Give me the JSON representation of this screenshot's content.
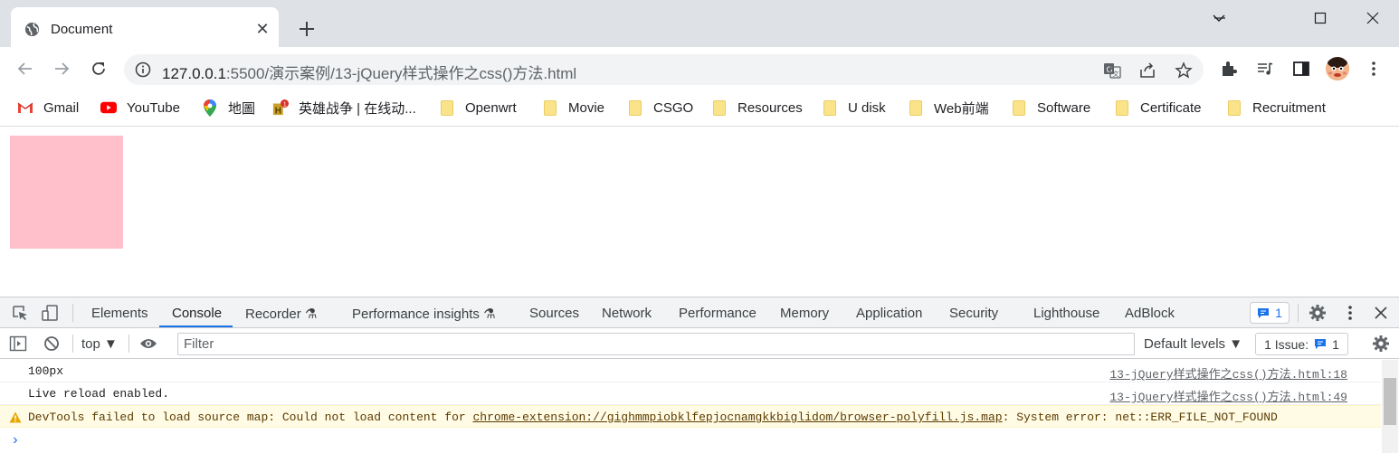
{
  "window": {
    "tab": {
      "title": "Document",
      "close_glyph": "✕"
    },
    "new_tab": "+"
  },
  "toolbar": {
    "url_host": "127.0.0.1",
    "url_path": ":5500/演示案例/13-jQuery样式操作之css()方法.html"
  },
  "bookmarks": [
    {
      "label": "Gmail",
      "icon": "gmail-icon"
    },
    {
      "label": "YouTube",
      "icon": "youtube-icon"
    },
    {
      "label": "地圖",
      "icon": "maps-icon"
    },
    {
      "label": "英雄战争 | 在线动...",
      "icon": "game-icon"
    },
    {
      "label": "Openwrt",
      "icon": "folder-icon"
    },
    {
      "label": "Movie",
      "icon": "folder-icon"
    },
    {
      "label": "CSGO",
      "icon": "folder-icon"
    },
    {
      "label": "Resources",
      "icon": "folder-icon"
    },
    {
      "label": "U disk",
      "icon": "folder-icon"
    },
    {
      "label": "Web前端",
      "icon": "folder-icon"
    },
    {
      "label": "Software",
      "icon": "folder-icon"
    },
    {
      "label": "Certificate",
      "icon": "folder-icon"
    },
    {
      "label": "Recruitment",
      "icon": "folder-icon"
    }
  ],
  "page": {
    "box_color": "#ffc0cb"
  },
  "devtools": {
    "tabs": [
      "Elements",
      "Console",
      "Recorder",
      "Performance insights",
      "Sources",
      "Network",
      "Performance",
      "Memory",
      "Application",
      "Security",
      "Lighthouse",
      "AdBlock"
    ],
    "active_tab": "Console",
    "message_count": "1",
    "context": "top",
    "filter_placeholder": "Filter",
    "levels": "Default levels",
    "issues_label": "1 Issue:",
    "issues_count": "1",
    "console": [
      {
        "text": "100px",
        "source": "13-jQuery样式操作之css()方法.html:18"
      },
      {
        "text": "Live reload enabled.",
        "source": "13-jQuery样式操作之css()方法.html:49"
      }
    ],
    "warning": {
      "prefix": "DevTools failed to load source map: Could not load content for ",
      "link": "chrome-extension://gighmmpiobklfepjocnamgkkbiglidom/browser-polyfill.js.map",
      "suffix": ": System error: net::ERR_FILE_NOT_FOUND"
    },
    "prompt": "›"
  },
  "colors": {
    "accent": "#1a73e8",
    "pink_box": "#ffc0cb",
    "warning_bg": "#fffbe5"
  }
}
